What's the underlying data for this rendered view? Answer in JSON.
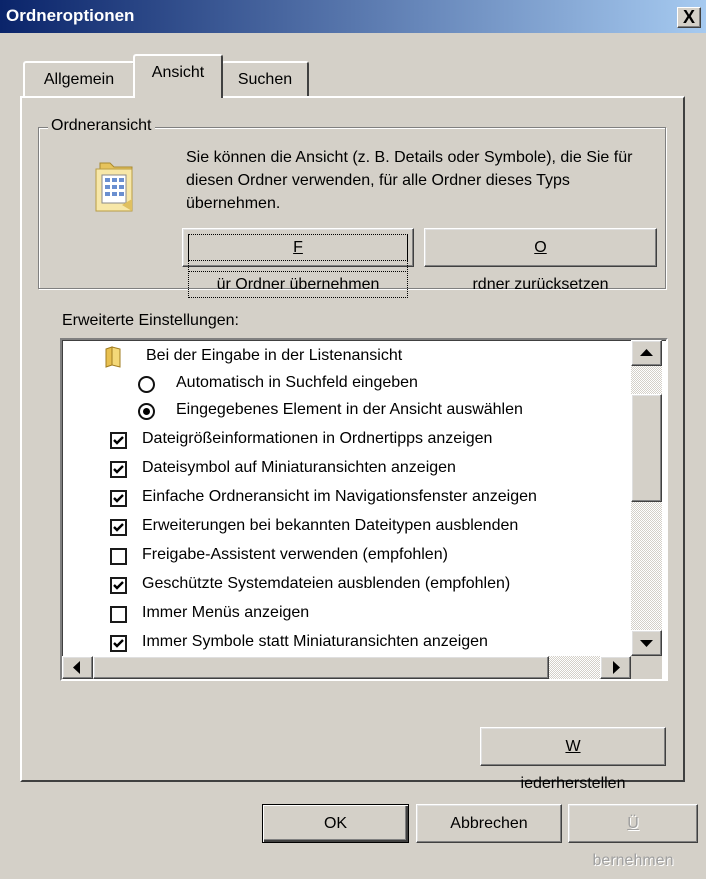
{
  "window": {
    "title": "Ordneroptionen",
    "close_glyph": "X"
  },
  "tabs": [
    {
      "label": "Allgemein",
      "active": false
    },
    {
      "label": "Ansicht",
      "active": true
    },
    {
      "label": "Suchen",
      "active": false
    }
  ],
  "folder_view": {
    "group_label": "Ordneransicht",
    "description": "Sie können die Ansicht (z. B. Details oder Symbole), die Sie für diesen Ordner verwenden, für alle Ordner dieses Typs übernehmen.",
    "apply_button": {
      "mnemonic": "F",
      "rest": "ür Ordner übernehmen"
    },
    "reset_button": {
      "mnemonic": "O",
      "rest": "rdner zurücksetzen"
    }
  },
  "advanced": {
    "label": "Erweiterte Einstellungen:",
    "items": [
      {
        "type": "folder",
        "label": "Bei der Eingabe in der Listenansicht"
      },
      {
        "type": "radio",
        "label": "Automatisch in Suchfeld eingeben",
        "checked": false
      },
      {
        "type": "radio",
        "label": "Eingegebenes Element in der Ansicht auswählen",
        "checked": true
      },
      {
        "type": "checkbox",
        "label": "Dateigrößeinformationen in Ordnertipps anzeigen",
        "checked": true
      },
      {
        "type": "checkbox",
        "label": "Dateisymbol auf Miniaturansichten anzeigen",
        "checked": true
      },
      {
        "type": "checkbox",
        "label": "Einfache Ordneransicht im Navigationsfenster anzeigen",
        "checked": true
      },
      {
        "type": "checkbox",
        "label": "Erweiterungen bei bekannten Dateitypen ausblenden",
        "checked": true
      },
      {
        "type": "checkbox",
        "label": "Freigabe-Assistent verwenden (empfohlen)",
        "checked": false
      },
      {
        "type": "checkbox",
        "label": "Geschützte Systemdateien ausblenden (empfohlen)",
        "checked": true
      },
      {
        "type": "checkbox",
        "label": "Immer Menüs anzeigen",
        "checked": false
      },
      {
        "type": "checkbox",
        "label": "Immer Symbole statt Miniaturansichten anzeigen",
        "checked": true
      }
    ],
    "restore_button": {
      "mnemonic": "W",
      "rest": "iederherstellen"
    }
  },
  "footer": {
    "ok_label": "OK",
    "cancel_label": "Abbrechen",
    "apply_button": {
      "mnemonic": "Ü",
      "rest": "bernehmen",
      "enabled": false
    }
  }
}
